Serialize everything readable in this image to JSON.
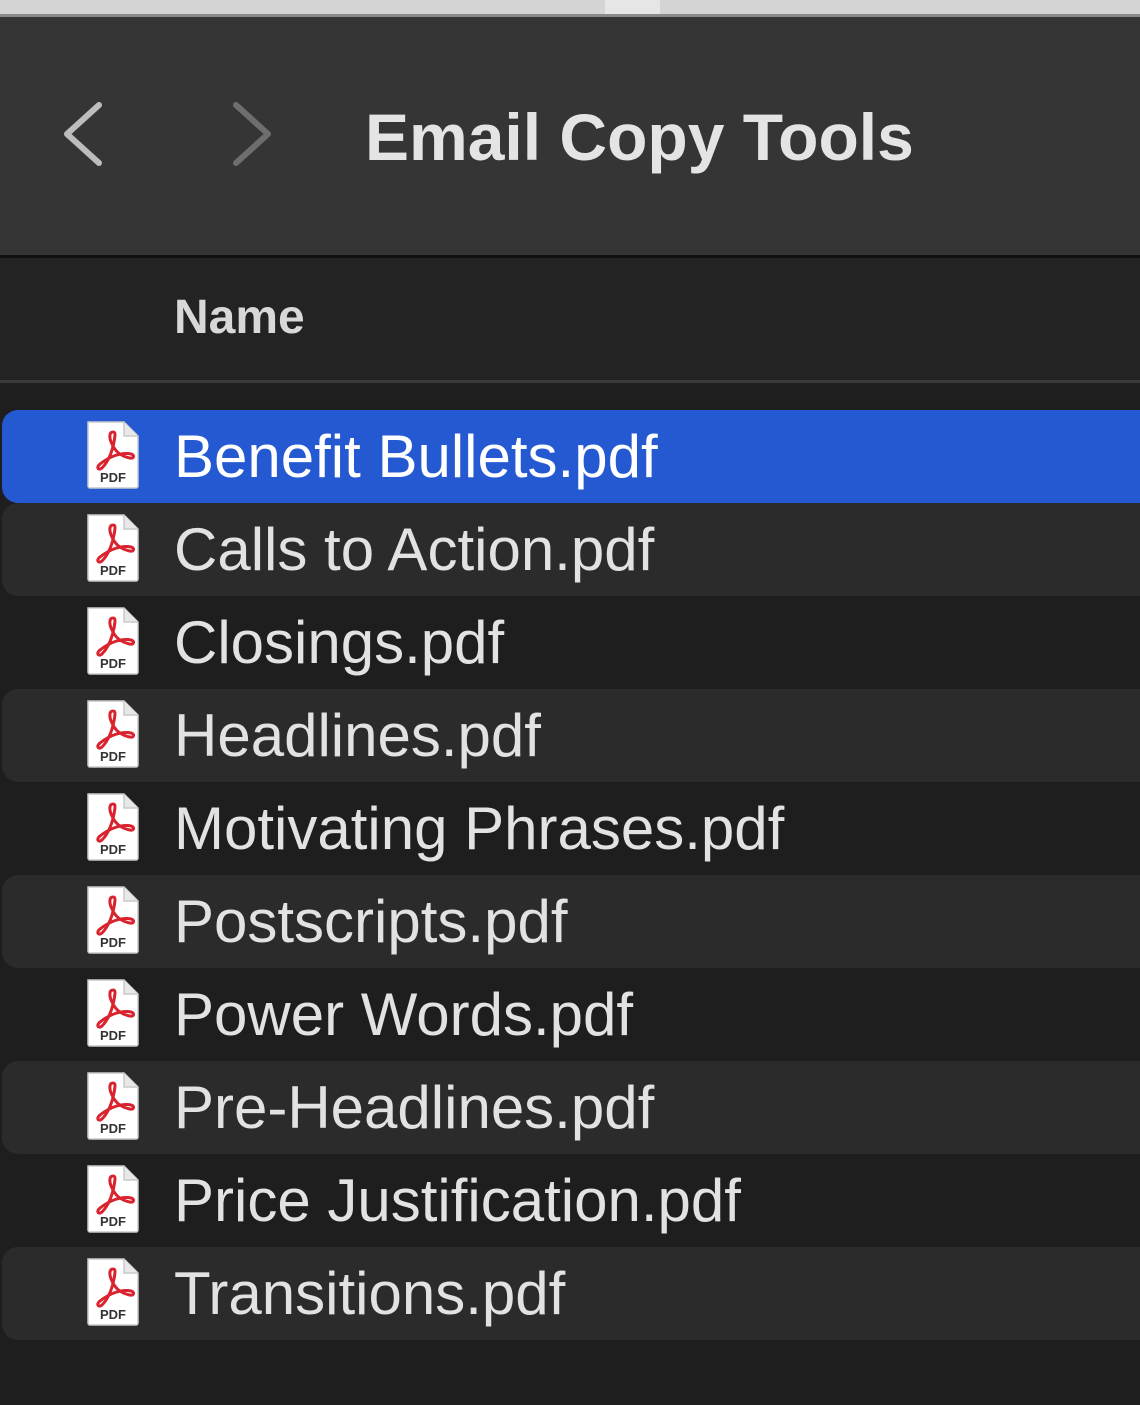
{
  "window": {
    "title": "Email Copy Tools"
  },
  "navigation": {
    "back_icon": "chevron-left-icon",
    "forward_icon": "chevron-right-icon"
  },
  "list": {
    "column_header": "Name",
    "file_icon": "pdf-file-icon",
    "selected_index": 0,
    "files": [
      {
        "name": "Benefit Bullets.pdf"
      },
      {
        "name": "Calls to Action.pdf"
      },
      {
        "name": "Closings.pdf"
      },
      {
        "name": "Headlines.pdf"
      },
      {
        "name": "Motivating Phrases.pdf"
      },
      {
        "name": "Postscripts.pdf"
      },
      {
        "name": "Power Words.pdf"
      },
      {
        "name": "Pre-Headlines.pdf"
      },
      {
        "name": "Price Justification.pdf"
      },
      {
        "name": "Transitions.pdf"
      }
    ],
    "pdf_badge": "PDF"
  },
  "colors": {
    "toolbar_bg": "#353535",
    "list_bg": "#1e1e1e",
    "alt_row_bg": "#2b2b2b",
    "selection": "#2459d2",
    "pdf_red": "#d9232e"
  }
}
